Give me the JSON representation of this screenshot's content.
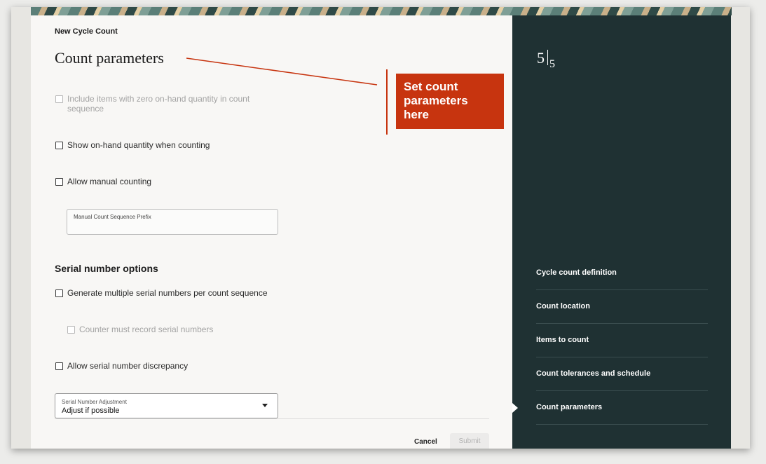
{
  "breadcrumb": "New Cycle Count",
  "page_title": "Count parameters",
  "callout_text": "Set count parameters here",
  "options": {
    "zero_onhand": "Include items with zero on-hand quantity in count sequence",
    "show_onhand": "Show on-hand quantity when counting",
    "allow_manual": "Allow manual counting",
    "manual_prefix_label": "Manual Count Sequence Prefix",
    "manual_prefix_value": ""
  },
  "serial": {
    "heading": "Serial number options",
    "generate_multiple": "Generate multiple serial numbers per count sequence",
    "counter_must_record": "Counter must record serial numbers",
    "allow_discrepancy": "Allow serial number discrepancy",
    "adjustment_label": "Serial Number Adjustment",
    "adjustment_value": "Adjust if possible"
  },
  "footer": {
    "cancel": "Cancel",
    "submit": "Submit"
  },
  "sidebar": {
    "current_step": "5",
    "total_steps": "5",
    "steps": [
      {
        "label": "Cycle count definition"
      },
      {
        "label": "Count location"
      },
      {
        "label": "Items to count"
      },
      {
        "label": "Count tolerances and schedule"
      },
      {
        "label": "Count parameters"
      }
    ]
  },
  "colors": {
    "accent": "#c7340f",
    "sidebar_bg": "#1f3133"
  }
}
